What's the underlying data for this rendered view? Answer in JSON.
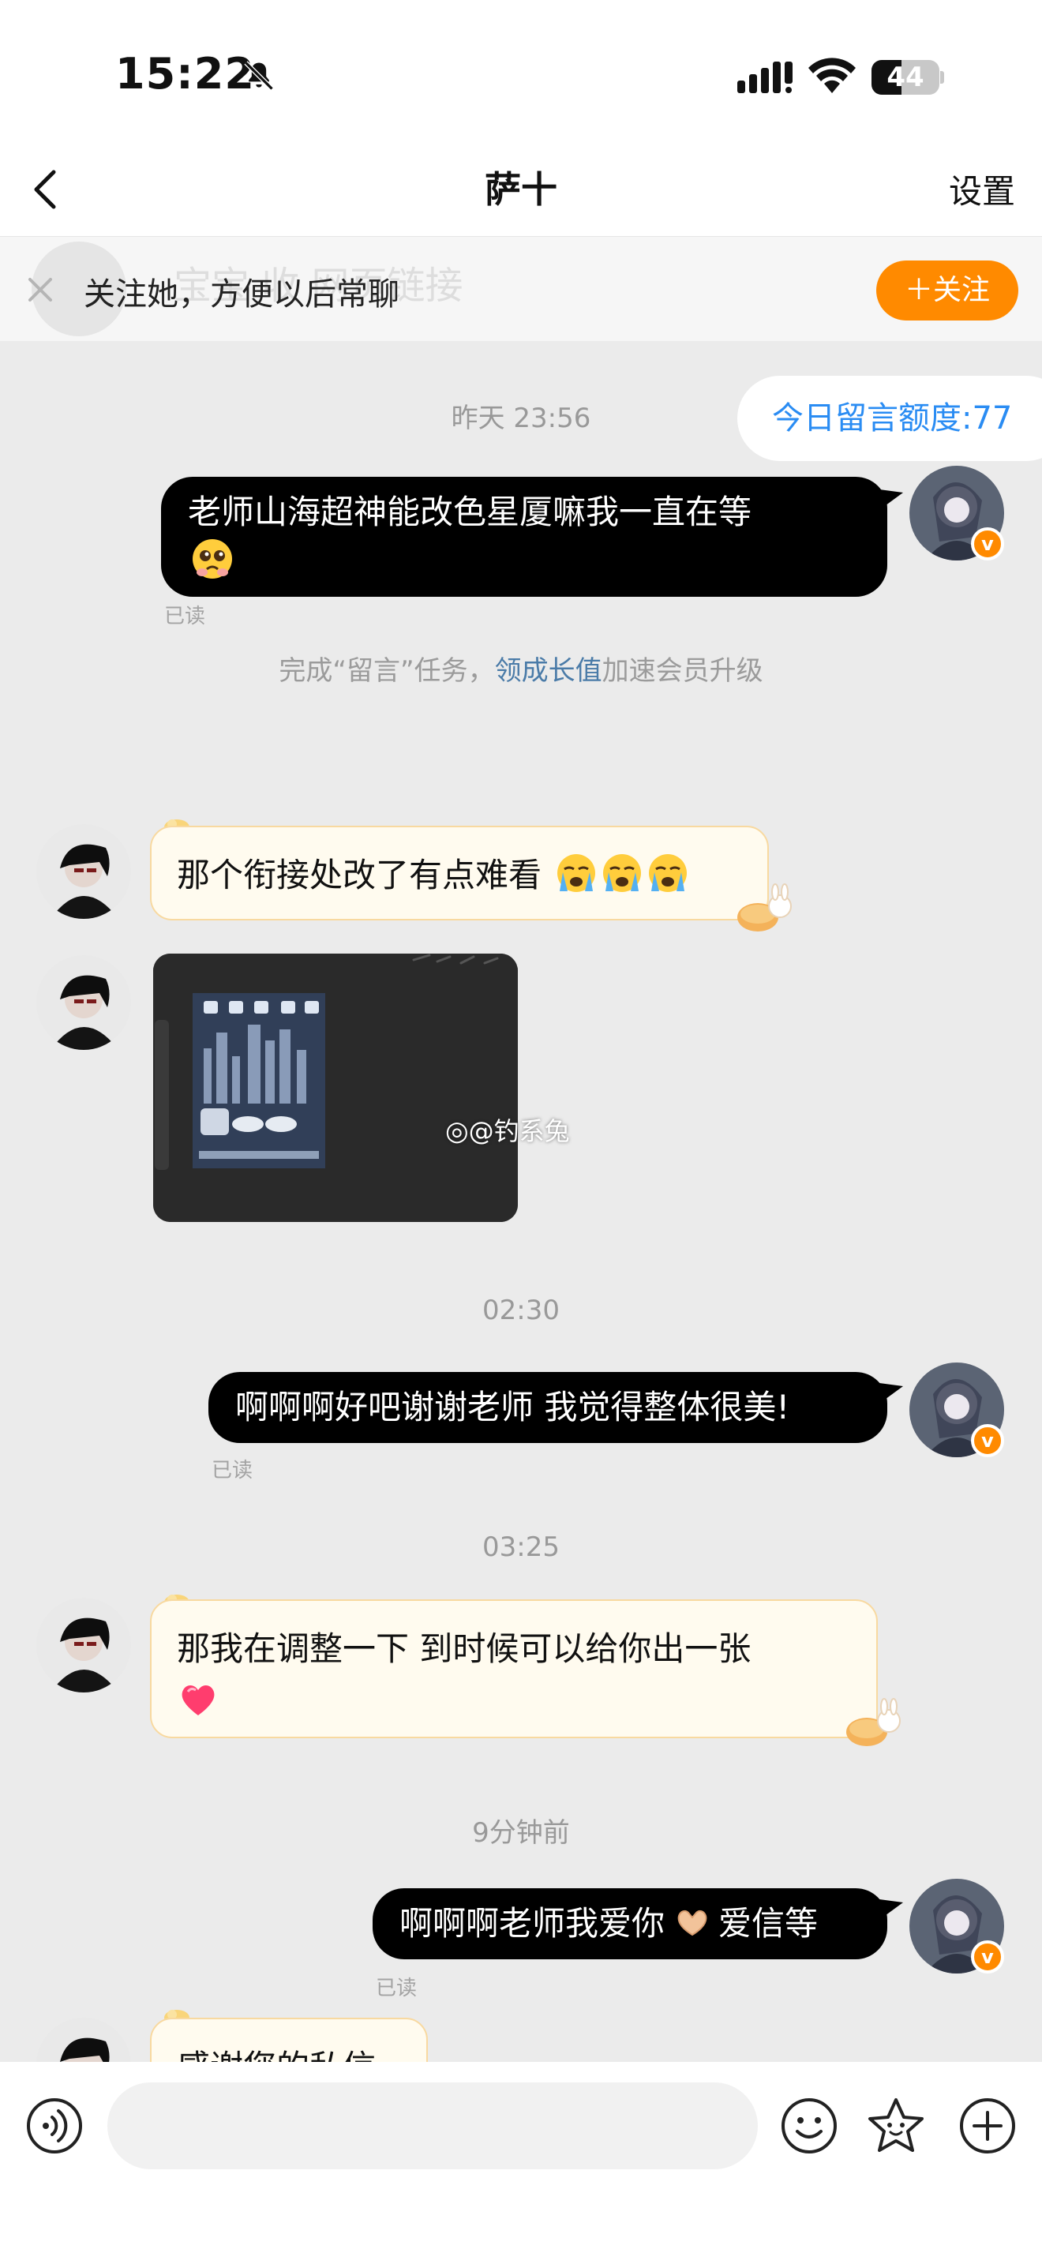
{
  "status_bar": {
    "time": "15:22",
    "battery": "44",
    "battery_level": 0.44
  },
  "nav": {
    "title": "萨十",
    "settings_label": "设置"
  },
  "follow_bar": {
    "message": "关注她，方便以后常聊",
    "button_label": "＋关注",
    "ghost_text": "宝宝 收 网页链接"
  },
  "quota": {
    "label": "今日留言额度:77"
  },
  "timestamps": [
    "昨天 23:56",
    "02:30",
    "03:25",
    "9分钟前"
  ],
  "system_notice": {
    "prefix": "完成“留言”任务，",
    "link": "领成长值",
    "suffix": "加速会员升级"
  },
  "read_label": "已读",
  "watermark": "@钓系兔",
  "messages": [
    {
      "side": "out",
      "text": "老师山海超神能改色星厦嘛我一直在等",
      "emoji": "pleading-face"
    },
    {
      "side": "in",
      "text": "那个衔接处改了有点难看",
      "emoji": "crying-face x3"
    },
    {
      "side": "in",
      "type": "image"
    },
    {
      "side": "out",
      "text": "啊啊啊好吧谢谢老师 我觉得整体很美!"
    },
    {
      "side": "in",
      "text": "那我在调整一下 到时候可以给你出一张",
      "emoji": "heart"
    },
    {
      "side": "out",
      "text": "啊啊啊老师我爱你",
      "suffix": "爱信等",
      "emoji": "heart-hands"
    },
    {
      "side": "in",
      "text": "感谢您的私信"
    }
  ],
  "colors": {
    "accent_orange": "#ff8a00",
    "quota_blue": "#2a8cf3",
    "link_blue": "#4a7ba8",
    "in_bubble": "#fffbef"
  },
  "icons": [
    "bell-off-icon",
    "signal-icon",
    "wifi-icon",
    "battery-icon",
    "back-icon",
    "close-icon",
    "voice-icon",
    "emoji-icon",
    "sticker-icon",
    "plus-icon",
    "verified-icon"
  ]
}
